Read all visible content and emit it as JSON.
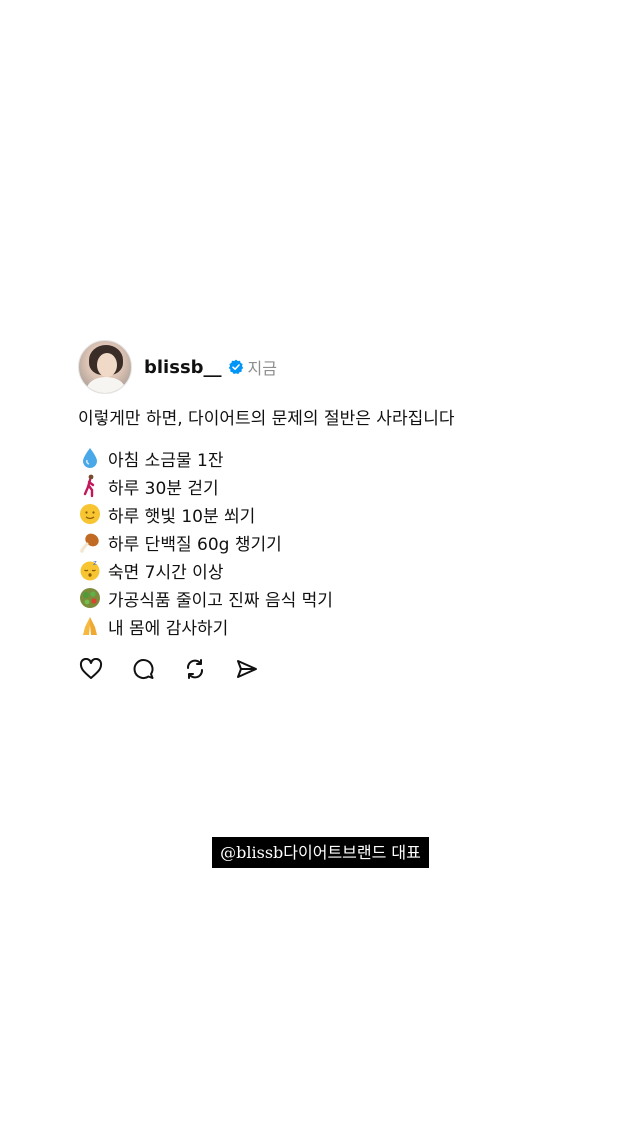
{
  "post": {
    "username": "blissb__",
    "time": "지금",
    "verified_icon": "verified-badge-icon",
    "caption": "이렇게만 하면, 다이어트의 문제의 절반은 사라집니다",
    "items": [
      {
        "icon": "droplet-icon",
        "text": "아침 소금물 1잔"
      },
      {
        "icon": "walking-person-icon",
        "text": "하루 30분 걷기"
      },
      {
        "icon": "sun-face-icon",
        "text": "하루 햇빛 10분 쐬기"
      },
      {
        "icon": "chicken-leg-icon",
        "text": "하루 단백질 60g 챙기기"
      },
      {
        "icon": "sleeping-face-icon",
        "text": "숙면 7시간 이상"
      },
      {
        "icon": "salad-icon",
        "text": "가공식품 줄이고 진짜 음식 먹기"
      },
      {
        "icon": "folded-hands-icon",
        "text": "내 몸에 감사하기"
      }
    ],
    "actions": [
      "heart-icon",
      "comment-icon",
      "repost-icon",
      "share-icon"
    ]
  },
  "watermark": "@blissb다이어트브랜드 대표",
  "colors": {
    "verified": "#0095f6",
    "meta_text": "#8e8e8e",
    "watermark_bg": "#000000"
  }
}
